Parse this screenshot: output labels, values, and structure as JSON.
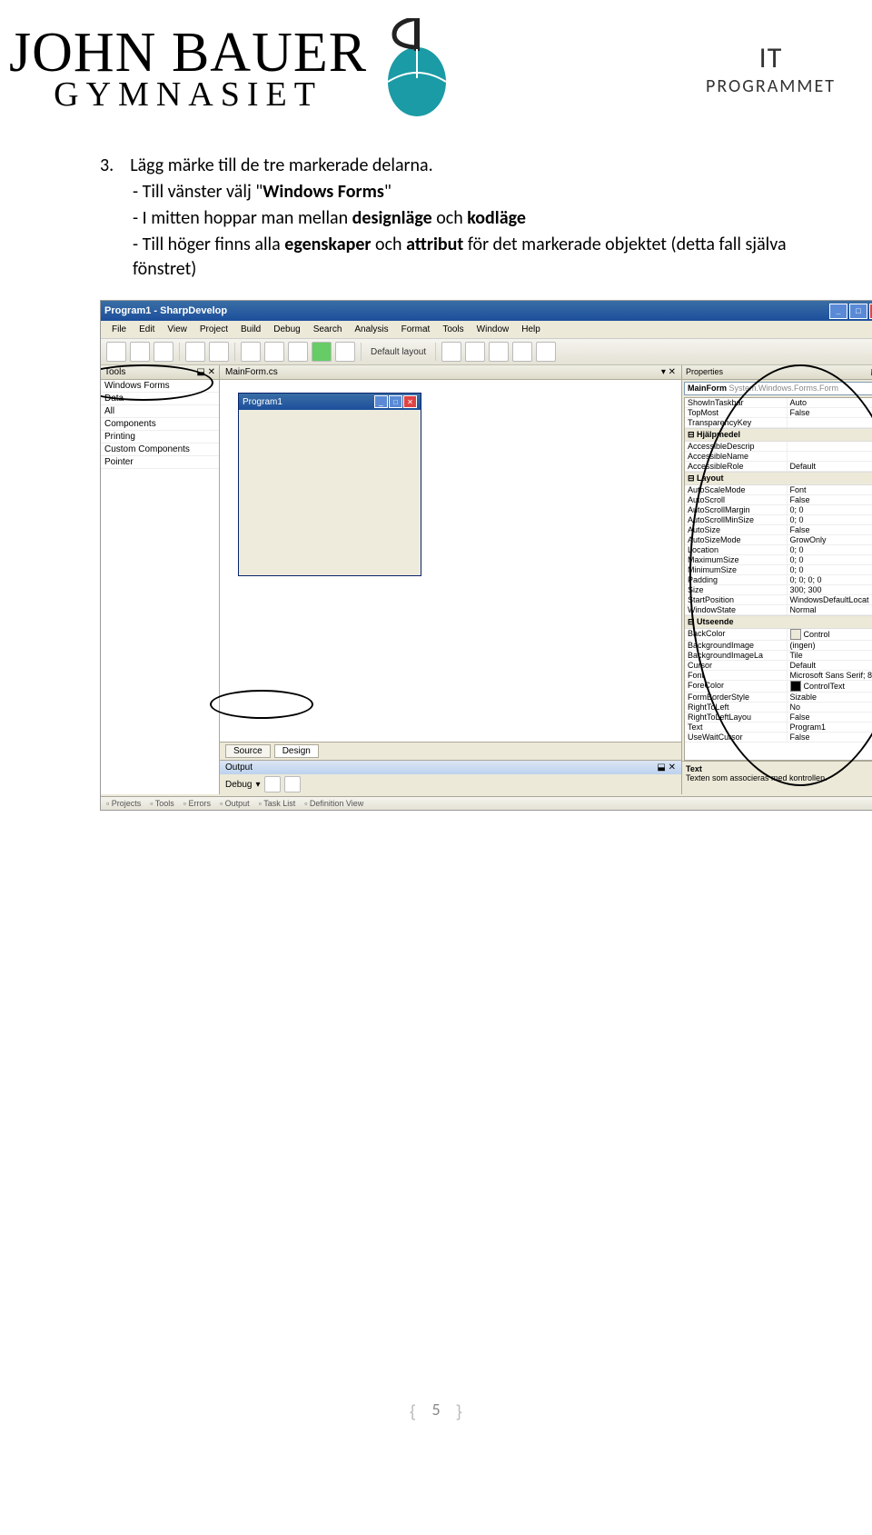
{
  "header": {
    "logo_line1": "JOHN BAUER",
    "logo_line2": "GYMNASIET",
    "right_l1": "IT",
    "right_l2": "PROGRAMMET"
  },
  "content": {
    "list_number": "3.",
    "para1": "Lägg märke till de tre markerade delarna.",
    "sub1_pre": "- Till vänster välj \"",
    "sub1_bold": "Windows Forms",
    "sub1_post": "\"",
    "sub2_pre": "- I mitten hoppar man mellan ",
    "sub2_b1": "designläge",
    "sub2_mid": " och ",
    "sub2_b2": "kodläge",
    "sub3_pre": "- Till höger finns alla ",
    "sub3_b1": "egenskaper",
    "sub3_mid": " och ",
    "sub3_b2": "attribut",
    "sub3_post": " för det markerade objektet (detta fall själva fönstret)"
  },
  "ide": {
    "title": "Program1 - SharpDevelop",
    "menu": [
      "File",
      "Edit",
      "View",
      "Project",
      "Build",
      "Debug",
      "Search",
      "Analysis",
      "Format",
      "Tools",
      "Window",
      "Help"
    ],
    "layout_label": "Default layout",
    "tools_title": "Tools",
    "pin": "⬓ ✕",
    "toolbox_items": [
      "Windows Forms",
      "Data",
      "All",
      "Components",
      "Printing",
      "Custom Components",
      "Pointer"
    ],
    "center_tab": "MainForm.cs",
    "form_title": "Program1",
    "bottom_tabs": {
      "source": "Source",
      "design": "Design"
    },
    "output_label": "Output",
    "debug_label": "Debug",
    "statusbar_items": [
      "Projects",
      "Tools",
      "Errors",
      "Output",
      "Task List",
      "Definition View"
    ],
    "properties": {
      "title": "Properties",
      "object": "MainForm",
      "object_type": "System.Windows.Forms.Form",
      "cats": [
        {
          "name": "",
          "rows": [
            {
              "n": "ShowInTaskbar",
              "v": "Auto"
            },
            {
              "n": "TopMost",
              "v": "False"
            },
            {
              "n": "TransparencyKey",
              "v": ""
            }
          ]
        },
        {
          "name": "Hjälpmedel",
          "rows": [
            {
              "n": "AccessibleDescrip",
              "v": ""
            },
            {
              "n": "AccessibleName",
              "v": ""
            },
            {
              "n": "AccessibleRole",
              "v": "Default"
            }
          ]
        },
        {
          "name": "Layout",
          "rows": [
            {
              "n": "AutoScaleMode",
              "v": "Font"
            },
            {
              "n": "AutoScroll",
              "v": "False"
            },
            {
              "n": "AutoScrollMargin",
              "v": "0; 0"
            },
            {
              "n": "AutoScrollMinSize",
              "v": "0; 0"
            },
            {
              "n": "AutoSize",
              "v": "False"
            },
            {
              "n": "AutoSizeMode",
              "v": "GrowOnly"
            },
            {
              "n": "Location",
              "v": "0; 0"
            },
            {
              "n": "MaximumSize",
              "v": "0; 0"
            },
            {
              "n": "MinimumSize",
              "v": "0; 0"
            },
            {
              "n": "Padding",
              "v": "0; 0; 0; 0"
            },
            {
              "n": "Size",
              "v": "300; 300"
            },
            {
              "n": "StartPosition",
              "v": "WindowsDefaultLocat"
            },
            {
              "n": "WindowState",
              "v": "Normal"
            }
          ]
        },
        {
          "name": "Utseende",
          "rows": [
            {
              "n": "BackColor",
              "v": "Control",
              "color": "#ece9d8"
            },
            {
              "n": "BackgroundImage",
              "v": "(ingen)"
            },
            {
              "n": "BackgroundImageLa",
              "v": "Tile"
            },
            {
              "n": "Cursor",
              "v": "Default"
            },
            {
              "n": "Font",
              "v": "Microsoft Sans Serif; 8"
            },
            {
              "n": "ForeColor",
              "v": "ControlText",
              "color": "#000000"
            },
            {
              "n": "FormBorderStyle",
              "v": "Sizable"
            },
            {
              "n": "RightToLeft",
              "v": "No"
            },
            {
              "n": "RightToLeftLayou",
              "v": "False"
            },
            {
              "n": "Text",
              "v": "Program1"
            },
            {
              "n": "UseWaitCursor",
              "v": "False"
            }
          ]
        }
      ],
      "desc_title": "Text",
      "desc_text": "Texten som associeras med kontrollen."
    }
  },
  "footer": {
    "page": "5"
  }
}
